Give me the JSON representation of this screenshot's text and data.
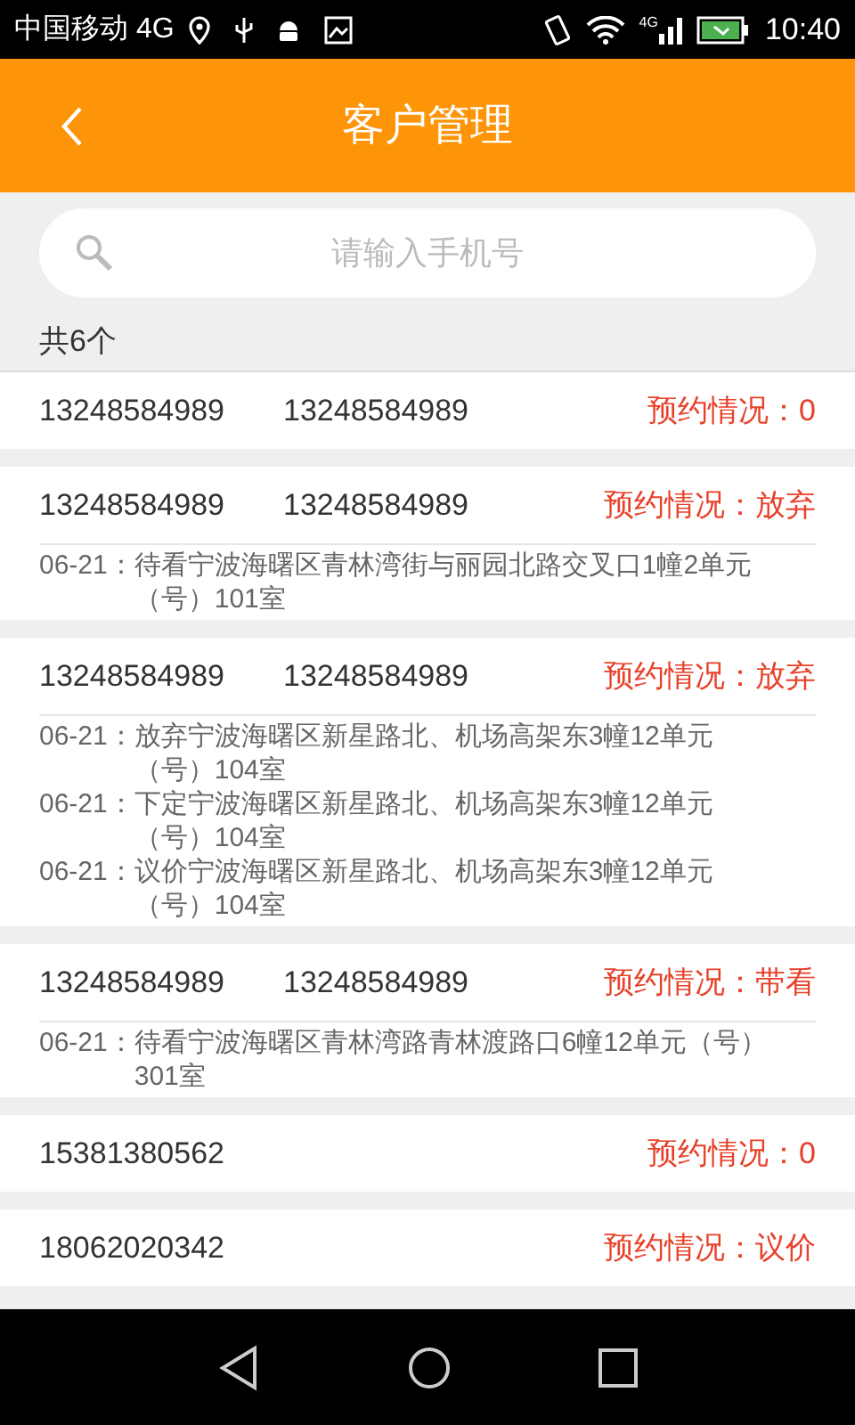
{
  "status_bar": {
    "carrier": "中国移动 4G",
    "network": "4G",
    "time": "10:40"
  },
  "header": {
    "title": "客户管理"
  },
  "search": {
    "placeholder": "请输入手机号"
  },
  "count": "共6个",
  "customers": [
    {
      "phones": [
        "13248584989",
        "13248584989"
      ],
      "status": "预约情况：0"
    },
    {
      "phones": [
        "13248584989",
        "13248584989"
      ],
      "status": "预约情况：放弃",
      "records": [
        {
          "date": "06-21：",
          "text": "待看宁波海曙区青林湾街与丽园北路交叉口1幢2单元（号）101室"
        }
      ]
    },
    {
      "phones": [
        "13248584989",
        "13248584989"
      ],
      "status": "预约情况：放弃",
      "records": [
        {
          "date": "06-21：",
          "text": "放弃宁波海曙区新星路北、机场高架东3幢12单元（号）104室"
        },
        {
          "date": "06-21：",
          "text": "下定宁波海曙区新星路北、机场高架东3幢12单元（号）104室"
        },
        {
          "date": "06-21：",
          "text": "议价宁波海曙区新星路北、机场高架东3幢12单元（号）104室"
        }
      ]
    },
    {
      "phones": [
        "13248584989",
        "13248584989"
      ],
      "status": "预约情况：带看",
      "records": [
        {
          "date": "06-21：",
          "text": "待看宁波海曙区青林湾路青林渡路口6幢12单元（号）301室"
        }
      ]
    },
    {
      "phones": [
        "15381380562"
      ],
      "status": "预约情况：0"
    },
    {
      "phones": [
        "18062020342"
      ],
      "status": "预约情况：议价"
    }
  ]
}
